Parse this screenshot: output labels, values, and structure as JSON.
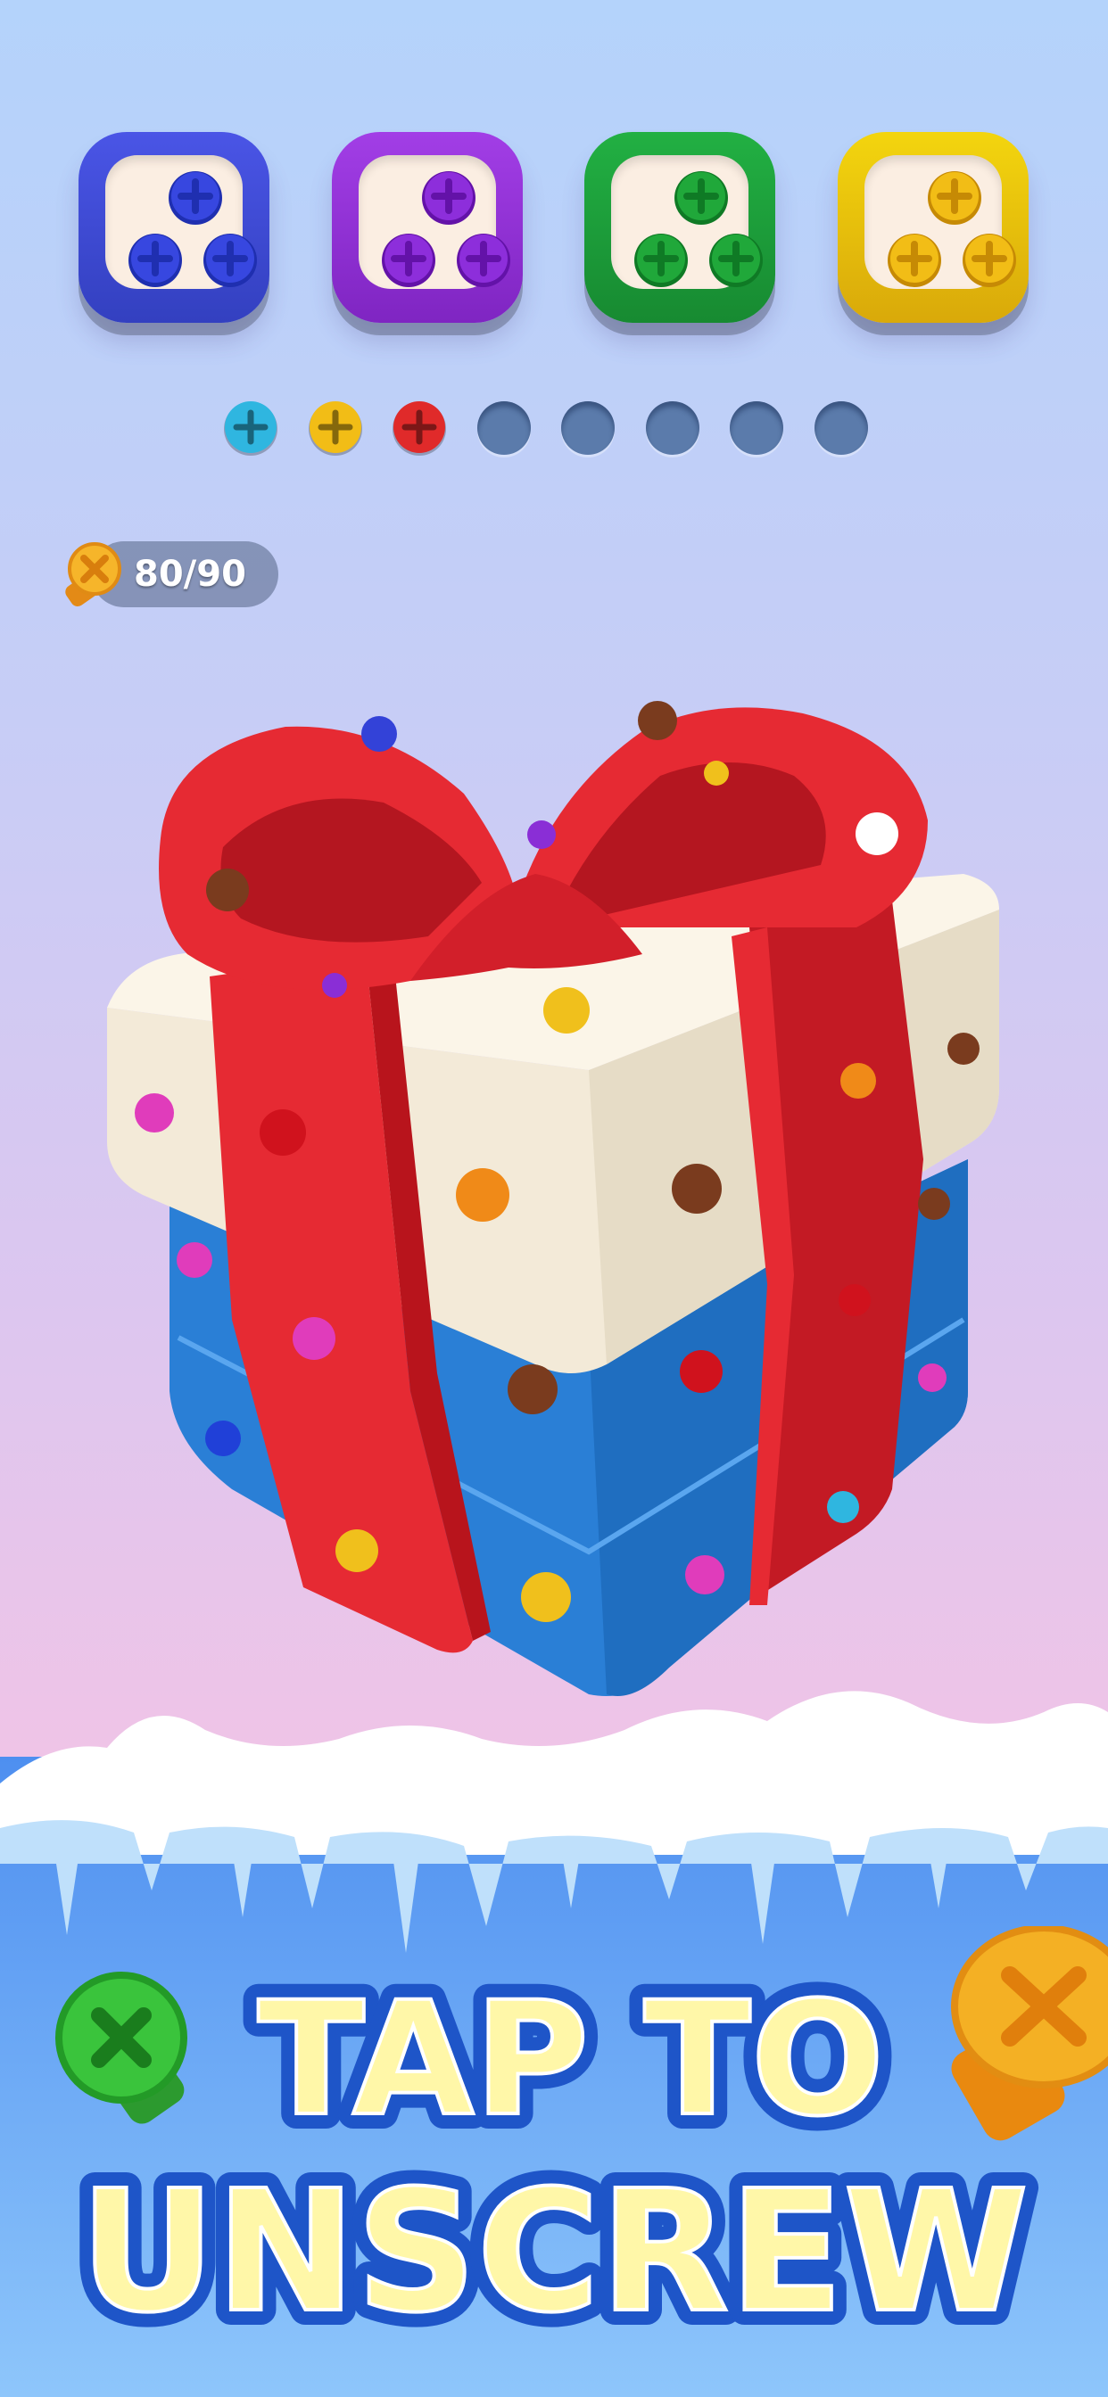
{
  "screw_boxes": [
    {
      "color_name": "blue",
      "shell": "#4a55e6",
      "shell_dark": "#3340c0",
      "screw": "#3747e0",
      "screw_dark": "#1f2fb0"
    },
    {
      "color_name": "purple",
      "shell": "#a23ee6",
      "shell_dark": "#7f25c2",
      "screw": "#8d2edb",
      "screw_dark": "#6312a8"
    },
    {
      "color_name": "green",
      "shell": "#22b043",
      "shell_dark": "#178a31",
      "screw": "#20a83a",
      "screw_dark": "#0f7a25"
    },
    {
      "color_name": "yellow",
      "shell": "#f3d50e",
      "shell_dark": "#d9a90a",
      "screw": "#f2bd16",
      "screw_dark": "#c68a05"
    }
  ],
  "holding_slots": [
    {
      "state": "filled",
      "color": "#2fb6e0",
      "icon": "cyan-screw-icon"
    },
    {
      "state": "filled",
      "color": "#f2bd16",
      "icon": "yellow-screw-icon"
    },
    {
      "state": "filled",
      "color": "#e02a2a",
      "icon": "red-screw-icon"
    },
    {
      "state": "empty"
    },
    {
      "state": "empty"
    },
    {
      "state": "empty"
    },
    {
      "state": "empty"
    },
    {
      "state": "empty"
    }
  ],
  "counter": {
    "icon": "screw-coin-icon",
    "value": "80/90",
    "removed": 80,
    "total": 90
  },
  "puzzle": {
    "object": "gift-box",
    "colors": {
      "ribbon": "#e9242f",
      "lid": "#f8f0e0",
      "base": "#2e86dc"
    }
  },
  "cta": {
    "line1": "TAP TO",
    "line2": "UNSCREW",
    "text_color": "#fff7a8",
    "outline_color": "#1e55c8"
  },
  "decor": {
    "left_icon": "green-screw-icon",
    "right_icon": "orange-screw-icon"
  }
}
